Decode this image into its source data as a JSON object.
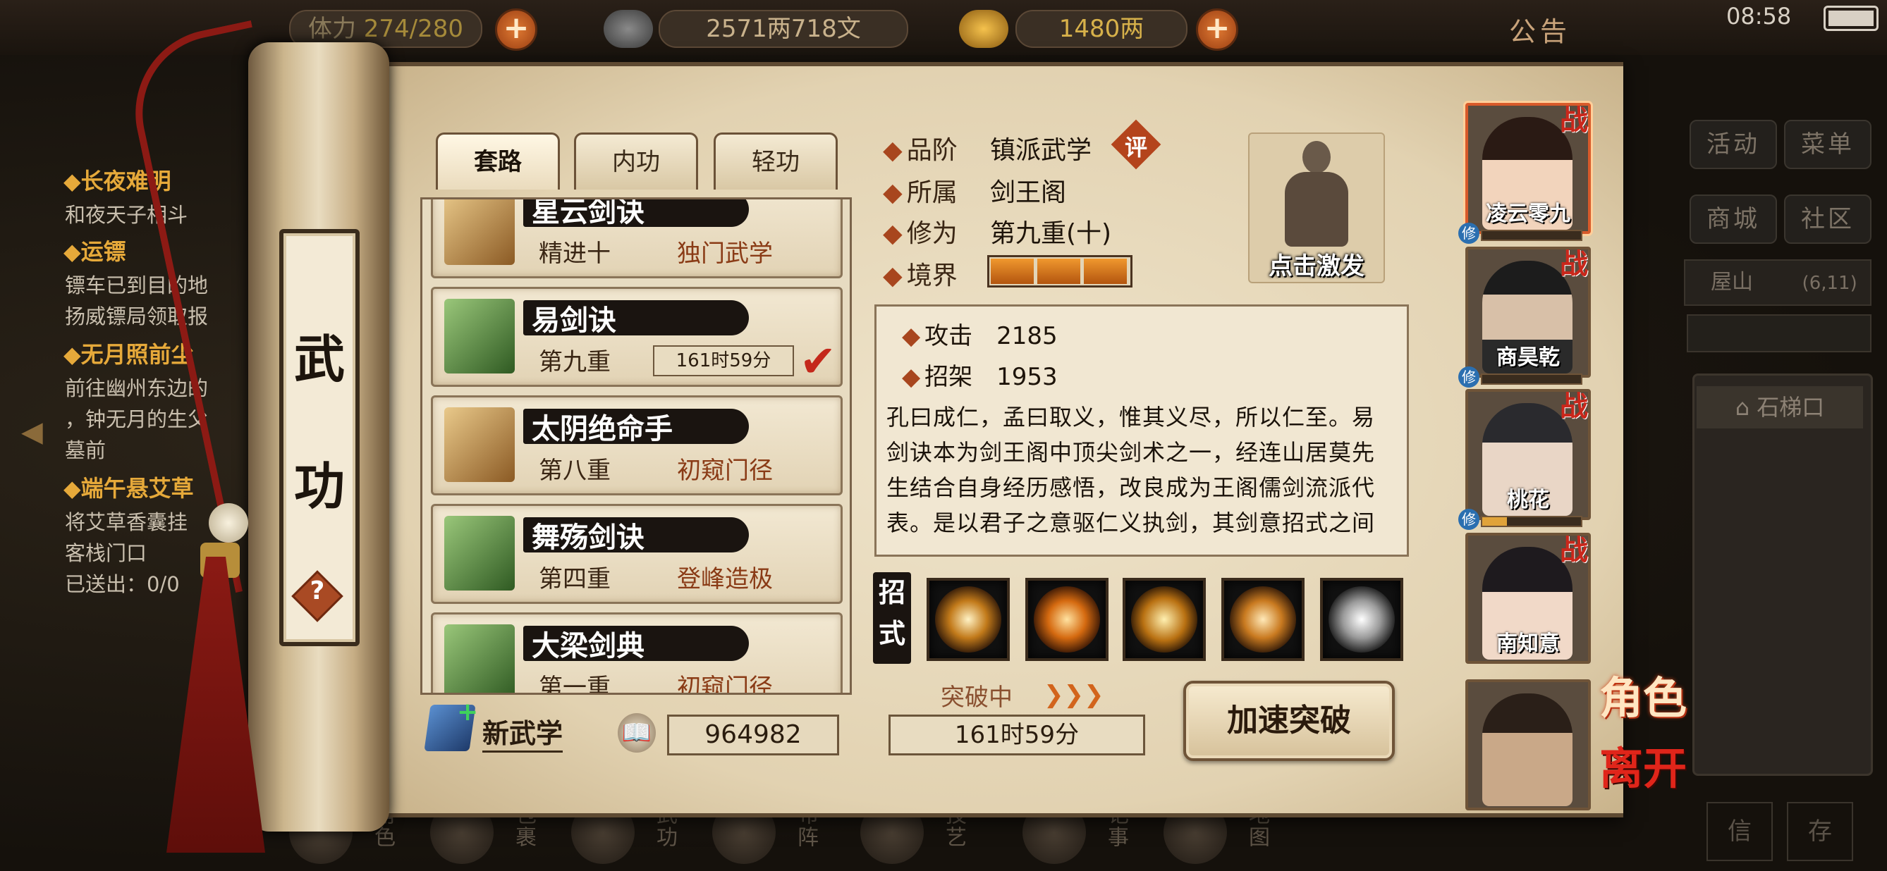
{
  "resources": {
    "stamina_label": "体力",
    "stamina": "274/280",
    "silver": "2571两718文",
    "gold": "1480两",
    "notice": "公告"
  },
  "status": {
    "time": "08:58"
  },
  "quests": [
    {
      "title": "◆长夜难明",
      "lines": [
        "和夜天子相斗"
      ]
    },
    {
      "title": "◆运镖",
      "lines": [
        "镖车已到目的地",
        "扬威镖局领取报"
      ]
    },
    {
      "title": "◆无月照前尘",
      "lines": [
        "前往幽州东边的",
        "，钟无月的生父",
        "墓前"
      ]
    },
    {
      "title": "◆端午悬艾草",
      "lines": [
        "将艾草香囊挂",
        "客栈门口",
        "已送出：0/0"
      ]
    }
  ],
  "side_menu": [
    "活动",
    "菜单",
    "商城",
    "社区"
  ],
  "location": {
    "name": "屋山",
    "coords": "(6,11)",
    "place": "石梯口"
  },
  "bottom_nav": [
    "角色",
    "包裹",
    "武功",
    "布阵",
    "技艺",
    "记事",
    "地图"
  ],
  "bottom_right": [
    "信",
    "存"
  ],
  "scroll_title": [
    "武",
    "功"
  ],
  "tabs": [
    "套路",
    "内功",
    "轻功"
  ],
  "skills": [
    {
      "name": "星云剑诀",
      "level": "精进十",
      "rank": "独门武学",
      "book": "gold"
    },
    {
      "name": "易剑诀",
      "level": "第九重",
      "timer": "161时59分",
      "book": "green",
      "selected": true
    },
    {
      "name": "太阴绝命手",
      "level": "第八重",
      "rank": "初窥门径",
      "book": "gold"
    },
    {
      "name": "舞殇剑诀",
      "level": "第四重",
      "rank": "登峰造极",
      "book": "green"
    },
    {
      "name": "大梁剑典",
      "level": "第一重",
      "rank": "初窥门径",
      "book": "green"
    }
  ],
  "new_skill_label": "新武学",
  "skill_points": "964982",
  "detail": {
    "grade_label": "品阶",
    "grade": "镇派武学",
    "eval": "评",
    "faction_label": "所属",
    "faction": "剑王阁",
    "cultivation_label": "修为",
    "cultivation": "第九重(十)",
    "realm_label": "境界",
    "realm_level": 3,
    "realm_max": 3,
    "activate": "点击激发",
    "attack_label": "攻击",
    "attack": "2185",
    "parry_label": "招架",
    "parry": "1953",
    "description": "孔曰成仁，孟曰取义，惟其义尽，所以仁至。易剑诀本为剑王阁中顶尖剑术之一，经连山居莫先生结合自身经历感悟，改良成为王阁儒剑流派代表。是以君子之意驱仁义执剑，其剑意招式之间平稳如泰山，注重团",
    "moves_label": "招式",
    "breakthrough_label": "突破中",
    "breakthrough_timer": "161时59分",
    "speedup": "加速突破"
  },
  "team": [
    {
      "name": "凌云零九",
      "battle": "战",
      "xiu": 0
    },
    {
      "name": "商昊乾",
      "battle": "战",
      "xiu": 0
    },
    {
      "name": "桃花",
      "battle": "战",
      "xiu": 0.25
    },
    {
      "name": "南知意",
      "battle": "战"
    },
    {
      "name": ""
    }
  ],
  "xiu_badge": "修",
  "side_actions": [
    "角色",
    "离开"
  ],
  "colors": {
    "accent": "#a8461e",
    "battle": "#c9271b",
    "paper": "#e2d2b1"
  }
}
